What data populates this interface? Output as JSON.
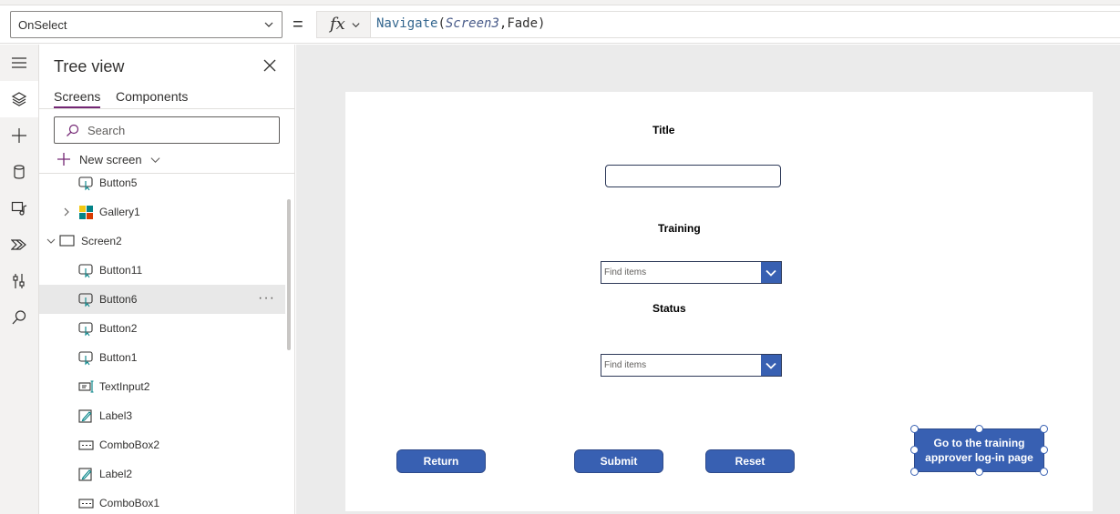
{
  "formula_bar": {
    "property": "OnSelect",
    "fx_label": "fx",
    "equals": "=",
    "formula": {
      "fn": "Navigate",
      "open": "(",
      "arg1": "Screen3",
      "comma": ",",
      "arg2": "Fade",
      "close": ")"
    }
  },
  "rail": {
    "items": [
      "hamburger-icon",
      "layers-icon",
      "plus-icon",
      "database-icon",
      "media-icon",
      "power-automate-icon",
      "tools-icon",
      "search-icon"
    ],
    "active_index": 1
  },
  "tree": {
    "title": "Tree view",
    "tabs": [
      {
        "label": "Screens",
        "active": true
      },
      {
        "label": "Components",
        "active": false
      }
    ],
    "search_placeholder": "Search",
    "new_screen_label": "New screen",
    "items": [
      {
        "label": "Button5",
        "icon": "button-icon",
        "level": 2
      },
      {
        "label": "Gallery1",
        "icon": "gallery-icon",
        "level": 2,
        "expander": "collapsed"
      },
      {
        "label": "Screen2",
        "icon": "screen-icon",
        "level": 1,
        "expander": "expanded"
      },
      {
        "label": "Button11",
        "icon": "button-icon",
        "level": 2
      },
      {
        "label": "Button6",
        "icon": "button-icon",
        "level": 2,
        "selected": true
      },
      {
        "label": "Button2",
        "icon": "button-icon",
        "level": 2
      },
      {
        "label": "Button1",
        "icon": "button-icon",
        "level": 2
      },
      {
        "label": "TextInput2",
        "icon": "text-input-icon",
        "level": 2
      },
      {
        "label": "Label3",
        "icon": "label-icon",
        "level": 2
      },
      {
        "label": "ComboBox2",
        "icon": "combobox-icon",
        "level": 2
      },
      {
        "label": "Label2",
        "icon": "label-icon",
        "level": 2
      },
      {
        "label": "ComboBox1",
        "icon": "combobox-icon",
        "level": 2
      }
    ],
    "more_label": "···"
  },
  "canvas": {
    "title_label": "Title",
    "training_label": "Training",
    "status_label": "Status",
    "combo_placeholder": "Find items",
    "buttons": {
      "return": "Return",
      "submit": "Submit",
      "reset": "Reset",
      "goto_line1": "Go to the training",
      "goto_line2": "approver log-in page"
    }
  },
  "colors": {
    "accent": "#742774",
    "button": "#3860b2",
    "canvas_bg": "#ebebeb"
  }
}
